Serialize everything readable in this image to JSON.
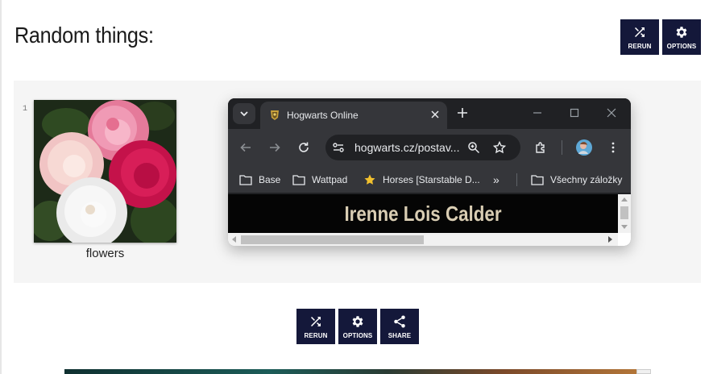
{
  "page": {
    "title": "Random things:",
    "header_buttons": {
      "rerun": "RERUN",
      "options": "OPTIONS"
    },
    "footer_buttons": {
      "rerun": "RERUN",
      "options": "OPTIONS",
      "share": "SHARE"
    },
    "accent_color": "#14183a"
  },
  "gallery": {
    "items": [
      {
        "index": "1",
        "caption": "flowers"
      }
    ]
  },
  "browser": {
    "tab": {
      "title": "Hogwarts Online"
    },
    "address": {
      "url": "hogwarts.cz/postav..."
    },
    "bookmarks": [
      "Base",
      "Wattpad",
      "Horses [Starstable D...",
      "Všechny záložky"
    ],
    "page_heading": "Irenne Lois Calder"
  },
  "icons": [
    "shuffle-icon",
    "gear-icon",
    "share-icon",
    "tab-search-icon",
    "close-icon",
    "plus-icon",
    "minimize-icon",
    "maximize-icon",
    "back-icon",
    "forward-icon",
    "reload-icon",
    "tune-icon",
    "zoom-icon",
    "star-icon",
    "extensions-icon",
    "profile-avatar",
    "more-icon",
    "folder-icon"
  ]
}
